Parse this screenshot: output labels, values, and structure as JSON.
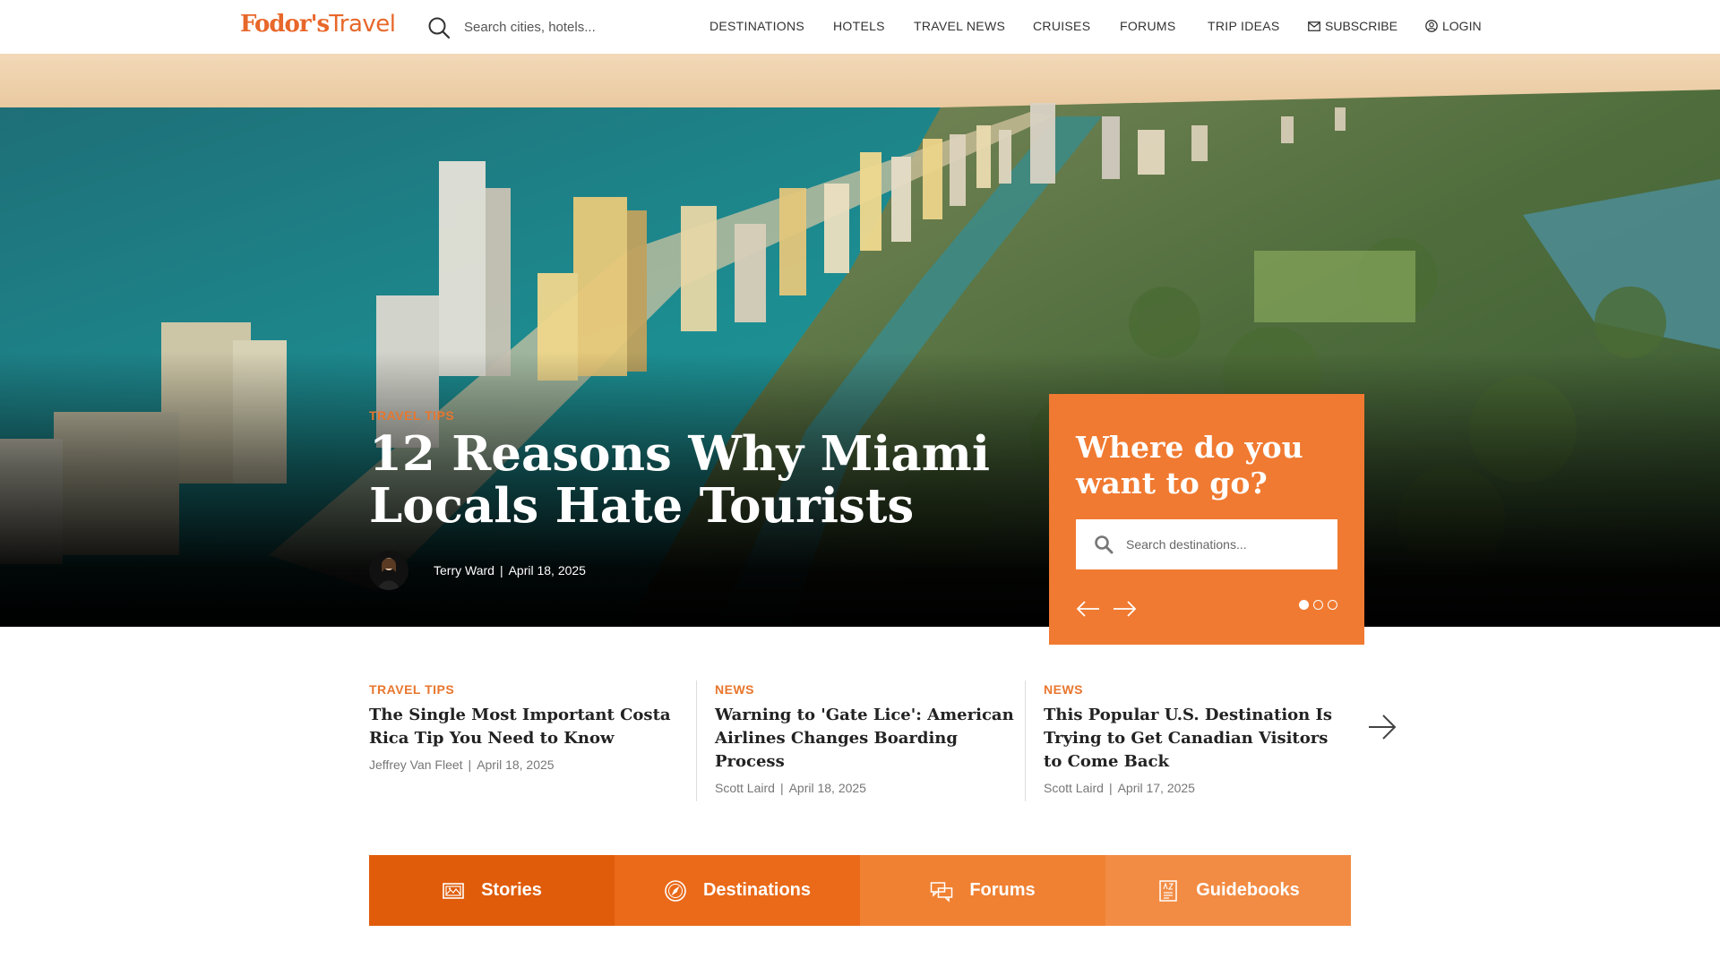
{
  "header": {
    "logo_bold": "Fodor's",
    "logo_light": "Travel",
    "search_placeholder": "Search cities, hotels...",
    "nav": [
      "DESTINATIONS",
      "HOTELS",
      "TRAVEL NEWS",
      "CRUISES",
      "FORUMS",
      "TRIP IDEAS"
    ],
    "subscribe_label": "SUBSCRIBE",
    "login_label": "LOGIN"
  },
  "hero": {
    "category": "TRAVEL TIPS",
    "title": "12 Reasons Why Miami Locals Hate Tourists",
    "author": "Terry Ward",
    "date": "April 18, 2025"
  },
  "where_box": {
    "title": "Where do you want to go?",
    "search_placeholder": "Search destinations...",
    "slides_total": 3,
    "slide_active": 1
  },
  "articles": [
    {
      "category": "TRAVEL TIPS",
      "title": "The Single Most Important Costa Rica Tip You Need to Know",
      "author": "Jeffrey Van Fleet",
      "date": "April 18, 2025"
    },
    {
      "category": "NEWS",
      "title": "Warning to 'Gate Lice': American Airlines Changes Boarding Process",
      "author": "Scott Laird",
      "date": "April 18, 2025"
    },
    {
      "category": "NEWS",
      "title": "This Popular U.S. Destination Is Trying to Get Canadian Visitors to Come Back",
      "author": "Scott Laird",
      "date": "April 17, 2025"
    }
  ],
  "tabs": [
    {
      "label": "Stories",
      "icon": "image-icon"
    },
    {
      "label": "Destinations",
      "icon": "compass-icon"
    },
    {
      "label": "Forums",
      "icon": "chat-bubbles-icon"
    },
    {
      "label": "Guidebooks",
      "icon": "book-icon"
    }
  ],
  "colors": {
    "brand_orange": "#e8672a",
    "box_orange": "#f07a31",
    "category_orange": "#e8762e"
  }
}
